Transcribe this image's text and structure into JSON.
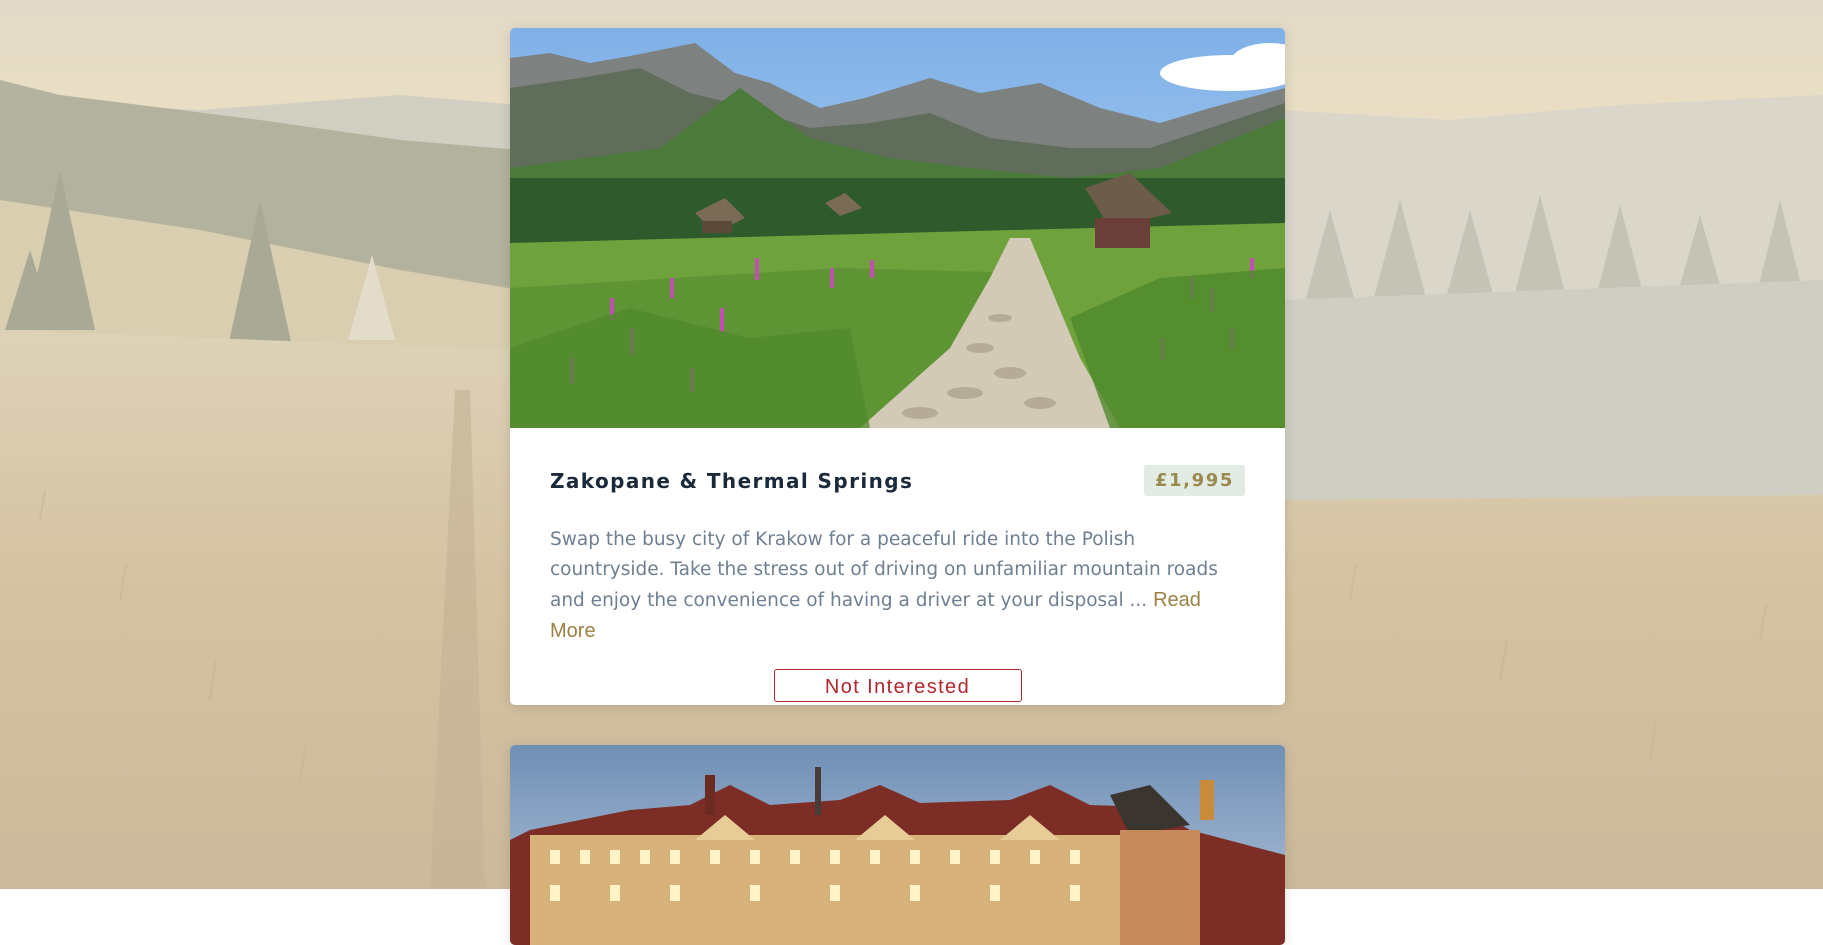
{
  "tours": [
    {
      "title": "Zakopane & Thermal Springs",
      "price": "£1,995",
      "description": "Swap the busy city of Krakow for a peaceful ride into the Polish countryside. Take the stress out of driving on unfamiliar mountain roads and enjoy the convenience of having a driver at your disposal ...",
      "read_more_label": "Read More",
      "dismiss_label": "Not Interested",
      "image_icon": "mountain-meadow-photo"
    },
    {
      "image_icon": "royal-castle-photo"
    }
  ],
  "colors": {
    "title": "#1a2a3a",
    "price_text": "#9b8a4e",
    "price_bg": "#e3ebe5",
    "description": "#6e7f92",
    "read_more": "#9b8142",
    "dismiss": "#b3262c"
  }
}
